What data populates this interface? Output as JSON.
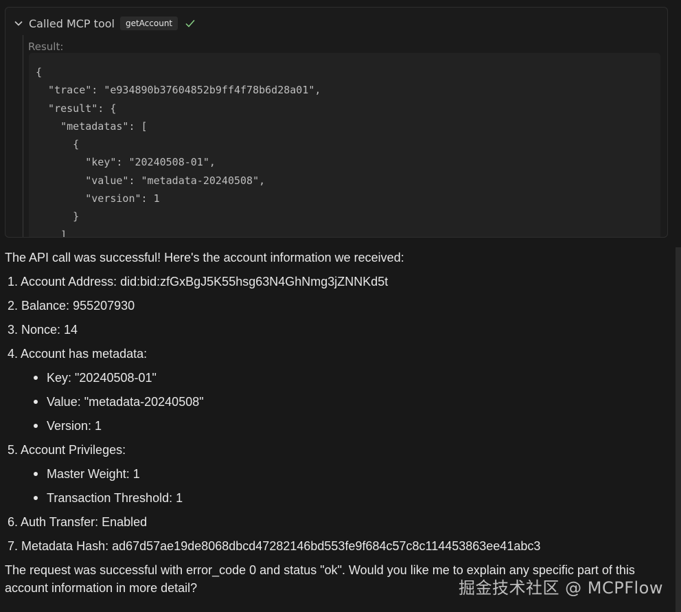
{
  "tool_call": {
    "title": "Called MCP tool",
    "tool_name": "getAccount",
    "result_label": "Result:",
    "code": "{\n  \"trace\": \"e934890b37604852b9ff4f78b6d28a01\",\n  \"result\": {\n    \"metadatas\": [\n      {\n        \"key\": \"20240508-01\",\n        \"value\": \"metadata-20240508\",\n        \"version\": 1\n      }\n    ]"
  },
  "message": {
    "intro": "The API call was successful! Here's the account information we received:",
    "items": [
      {
        "label": "1. Account Address: did:bid:zfGxBgJ5K55hsg63N4GhNmg3jZNNKd5t"
      },
      {
        "label": "2. Balance: 955207930"
      },
      {
        "label": "3. Nonce: 14"
      },
      {
        "label": "4. Account has metadata:",
        "sub": [
          "Key: \"20240508-01\"",
          "Value: \"metadata-20240508\"",
          "Version: 1"
        ]
      },
      {
        "label": "5. Account Privileges:",
        "sub": [
          "Master Weight: 1",
          "Transaction Threshold: 1"
        ]
      },
      {
        "label": "6. Auth Transfer: Enabled"
      },
      {
        "label": "7. Metadata Hash: ad67d57ae19de8068dbcd47282146bd553fe9f684c57c8c114453863ee41abc3"
      }
    ],
    "outro": "The request was successful with error_code 0 and status \"ok\". Would you like me to explain any specific part of this account information in more detail?"
  },
  "watermark": "掘金技术社区 @ MCPFlow",
  "colors": {
    "background": "#181818",
    "text": "#e8e8e8",
    "check": "#89d185"
  }
}
